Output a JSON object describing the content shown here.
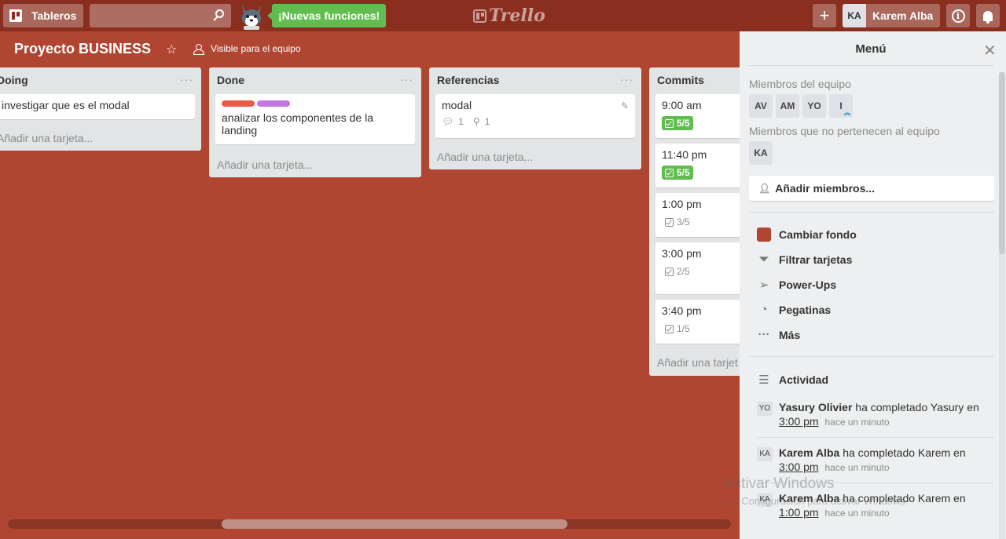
{
  "header": {
    "boards_label": "Tableros",
    "search_value": "",
    "new_features_label": "¡Nuevas funciones!",
    "logo_text": "Trello",
    "add_icon": "+",
    "user_initials": "KA",
    "user_name": "Karem Alba",
    "info_icon": "i"
  },
  "board": {
    "title": "Proyecto BUSINESS",
    "visibility": "Visible para el equipo",
    "background_color": "#b04632"
  },
  "lists": [
    {
      "title": "Doing",
      "menu": "···",
      "cards": [
        {
          "title": "investigar que es el modal"
        }
      ],
      "add_card": "Añadir una tarjeta..."
    },
    {
      "title": "Done",
      "menu": "···",
      "cards": [
        {
          "title": "analizar los componentes de la landing",
          "labels": [
            "#eb5a46",
            "#c377e0"
          ]
        }
      ],
      "add_card": "Añadir una tarjeta..."
    },
    {
      "title": "Referencias",
      "menu": "···",
      "cards": [
        {
          "title": "modal",
          "comments": "1",
          "attachments": "1"
        }
      ],
      "add_card": "Añadir una tarjeta..."
    },
    {
      "title": "Commits",
      "cards": [
        {
          "title": "9:00 am",
          "checklist": "5/5"
        },
        {
          "title": "11:40 pm",
          "checklist": "5/5"
        },
        {
          "title": "1:00 pm",
          "checklist": "3/5"
        },
        {
          "title": "3:00 pm",
          "checklist": "2/5"
        },
        {
          "title": "3:40 pm",
          "checklist": "1/5"
        }
      ],
      "add_card": "Añadir una tarjet"
    }
  ],
  "menu": {
    "title": "Menú",
    "team_members_label": "Miembros del equipo",
    "team_members": [
      "AV",
      "AM",
      "YO",
      "I"
    ],
    "non_team_members_label": "Miembros que no pertenecen al equipo",
    "non_team_members": [
      "KA"
    ],
    "add_members": "Añadir miembros...",
    "items": [
      {
        "label": "Cambiar fondo",
        "icon": "color-swatch"
      },
      {
        "label": "Filtrar tarjetas",
        "icon": "filter-icon"
      },
      {
        "label": "Power-Ups",
        "icon": "rocket-icon"
      },
      {
        "label": "Pegatinas",
        "icon": "sticker-icon"
      },
      {
        "label": "Más",
        "icon": "more-icon"
      }
    ],
    "activity_label": "Actividad",
    "activity": [
      {
        "initials": "YO",
        "user": "Yasury Olivier",
        "text": "ha completado Yasury en",
        "link": "3:00 pm",
        "time": "hace un minuto"
      },
      {
        "initials": "KA",
        "user": "Karem Alba",
        "text": "ha completado Karem en",
        "link": "3:00 pm",
        "time": "hace un minuto"
      },
      {
        "initials": "KA",
        "user": "Karem Alba",
        "text": "ha completado Karem en",
        "link": "1:00 pm",
        "time": "hace un minuto"
      }
    ]
  },
  "system": {
    "watermark_title": "Activar Windows",
    "watermark_sub": "Ir a Configuración para activar Windows."
  },
  "colors": {
    "header": "#8a2f1f",
    "green": "#61bd4f",
    "sidebar": "#edeff0"
  }
}
